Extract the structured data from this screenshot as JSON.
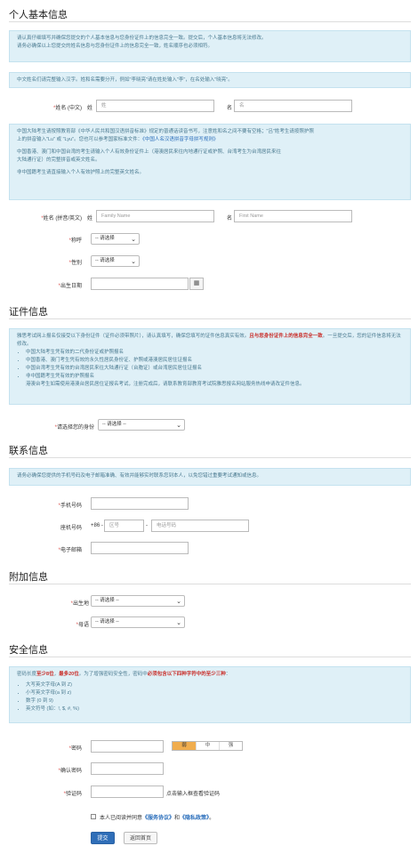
{
  "personal": {
    "title": "个人基本信息",
    "notice1": "请认真仔细填写并确保您提交的个人基本信息与您身份证件上的信息完全一致。提交后，个人基本信息将无法修改。",
    "notice2": "请务必确保以上您提交的姓名信息与您身份证件上的信息完全一致，姓名顺序也必须相符。",
    "notice3": "中文姓名们请完整输入汉字。姓和名需要分开，例如\"李晓亮\"请在姓处输入\"李\"，在名处输入\"晓亮\"。",
    "name_cn_label": "姓名 (中文)",
    "surname_label": "姓",
    "given_label": "名",
    "surname_placeholder": "姓",
    "given_placeholder": "名",
    "notice4a": "中国大陆考生请按照教育部《中华人民共和国汉语拼音标准》规定的普通话读音书写，注意姓和名之间不要有空格；\"吕\"姓考生请按照护照",
    "notice4b": "上的拼音输入\"Lu\" 或 \"Lyu\"。您也可以参考国家标准文件：",
    "notice4_link": "《中国人名汉语拼音字母拼写规则》",
    "notice5a": "中国香港、澳门和中国台湾的考生请输入个人有效身份证件上（港澳居民来往内地通行证或护照、台湾考生为台湾居民来往",
    "notice5b": "大陆通行证）的完整拼音或英文姓名。",
    "notice6": "非中国籍考生请直接输入个人有效护照上的完整英文姓名。",
    "name_en_label": "姓名 (拼音/英文)",
    "family_placeholder": "Family Name",
    "first_placeholder": "First Name",
    "title_label": "称呼",
    "gender_label": "性别",
    "dob_label": "出生日期",
    "select_default": "-- 请选择"
  },
  "id": {
    "title": "证件信息",
    "notice_a": "雅思考试网上报名仅接受以下身份证件（证件必须带照片），请认真填写，确保您填写的证件信息真实有效。",
    "notice_red": "且与您身份证件上的信息完全一致",
    "notice_b": "。一旦提交后，您的证件信息将无法修改。",
    "items": [
      "中国大陆考生凭有效的二代身份证或护照报名",
      "中国香港、澳门考生凭有效的永久性居民身份证、护照或港澳居民居住证报名",
      "中国台湾考生凭有效的台湾居民来往大陆通行证（台胞证）或台湾居民居住证报名",
      "非中国籍考生凭有效的护照报名"
    ],
    "notice_c": "港澳台考生如需使用港澳台居民居住证报名考试，注册完成后，请联系教育部教育考试院雅思报名网站服务热线申请改证件信息。",
    "label": "请选择您的身份",
    "select_default": "-- 请选择 --"
  },
  "contact": {
    "title": "联系信息",
    "notice": "请务必确保您提供的手机号码及电子邮箱准确、有效并能够实时联系您到本人，以免您错过重要考试通知或信息。",
    "mobile_label": "手机号码",
    "phone_label": "座机号码",
    "phone_prefix": "+86 -",
    "area_placeholder": "区号",
    "phone_placeholder": "电话号码",
    "email_label": "电子邮箱"
  },
  "extra": {
    "title": "附加信息",
    "birthplace_label": "出生地",
    "native_lang_label": "母语",
    "select_default": "-- 请选择 --"
  },
  "security": {
    "title": "安全信息",
    "notice_a": "密码长度",
    "notice_r1": "至少8位",
    "notice_sep": "，",
    "notice_r2": "最多20位",
    "notice_b": "。为了增强密码安全性，密码中",
    "notice_r3": "必须包含以下四种字符中的至少三种",
    "notice_c": "：",
    "rules": [
      "大写英文字母(A 到 Z)",
      "小写英文字母(a 到 z)",
      "数字 (0 到 9)",
      "英文符号 (如：!, $, #, %)"
    ],
    "password_label": "密码",
    "strength": [
      "弱",
      "中",
      "强"
    ],
    "confirm_label": "确认密码",
    "captcha_label": "验证码",
    "captcha_hint": "点击输入框查看验证码",
    "agree_prefix": "本人已阅读并同意",
    "agree_link1": "《服务协议》",
    "agree_and": "和",
    "agree_link2": "《隐私政策》",
    "agree_suffix": "。"
  },
  "actions": {
    "submit": "提交",
    "home": "返回首页"
  },
  "colors": {
    "info_bg": "#dff0f7",
    "accent": "#2f6eb8",
    "required": "#d9534f",
    "strength_weak": "#f0ad4e"
  }
}
